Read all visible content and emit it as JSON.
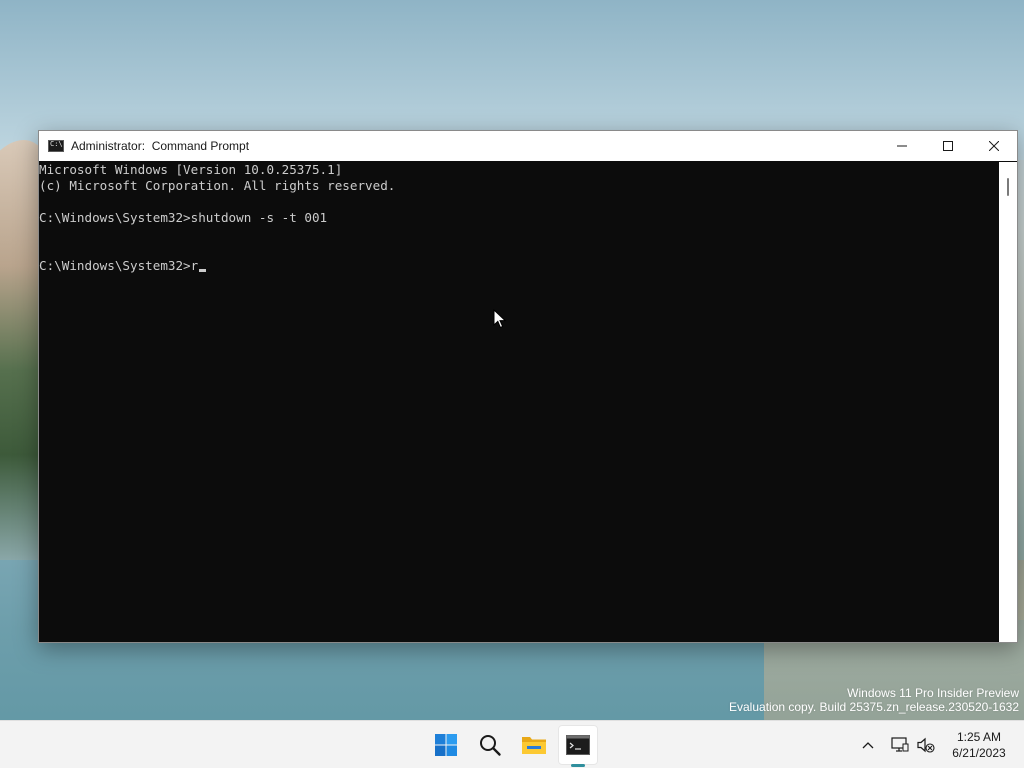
{
  "window": {
    "title": "Administrator:  Command Prompt",
    "controls": {
      "minimize": "minimize-icon",
      "maximize": "maximize-icon",
      "close": "close-icon"
    }
  },
  "console": {
    "lines": [
      "Microsoft Windows [Version 10.0.25375.1]",
      "(c) Microsoft Corporation. All rights reserved.",
      "",
      "C:\\Windows\\System32>shutdown -s -t 001",
      "",
      "",
      "C:\\Windows\\System32>r"
    ]
  },
  "watermark": {
    "line1": "Windows 11 Pro Insider Preview",
    "line2": "Evaluation copy. Build 25375.zn_release.230520-1632"
  },
  "taskbar": {
    "apps": [
      {
        "name": "start-icon"
      },
      {
        "name": "search-icon"
      },
      {
        "name": "file-explorer-icon"
      },
      {
        "name": "command-prompt-icon",
        "active": true
      }
    ],
    "tray": {
      "chevron": "chevron-up-icon",
      "network": "network-icon",
      "volume": "volume-muted-icon"
    },
    "clock": {
      "time": "1:25 AM",
      "date": "6/21/2023"
    }
  },
  "colors": {
    "console_bg": "#0c0c0c",
    "console_fg": "#cccccc",
    "accent": "#2f8f9d",
    "windows_blue": "#0078d4"
  }
}
